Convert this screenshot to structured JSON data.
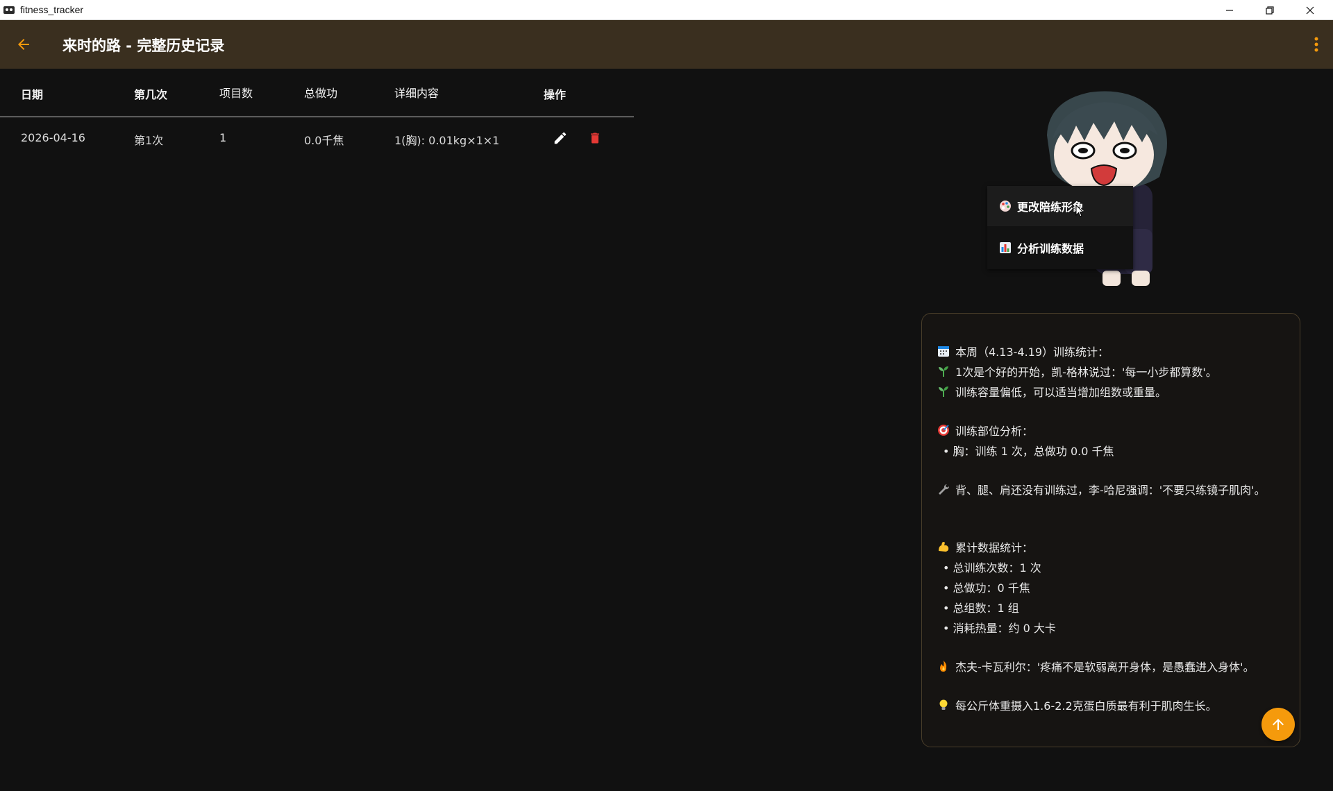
{
  "window": {
    "title": "fitness_tracker"
  },
  "appbar": {
    "title": "来时的路 - 完整历史记录"
  },
  "table": {
    "headers": {
      "date": "日期",
      "nth": "第几次",
      "items": "项目数",
      "work": "总做功",
      "detail": "详细内容",
      "actions": "操作"
    },
    "rows": [
      {
        "date": "2026-04-16",
        "nth": "第1次",
        "items": "1",
        "work": "0.0千焦",
        "detail": "1(胸): 0.01kg×1×1"
      }
    ]
  },
  "menu": {
    "items": [
      {
        "label": "更改陪练形象",
        "icon": "palette-icon"
      },
      {
        "label": "分析训练数据",
        "icon": "bar-chart-icon"
      }
    ]
  },
  "stats": {
    "week_title": "本周（4.13-4.19）训练统计：",
    "week_lines": [
      "1次是个好的开始，凯-格林说过：'每一小步都算数'。",
      "训练容量偏低，可以适当增加组数或重量。"
    ],
    "parts_title": "训练部位分析：",
    "parts_lines": [
      "• 胸：训练 1 次，总做功 0.0 千焦"
    ],
    "untrained": "背、腿、肩还没有训练过，李-哈尼强调：'不要只练镜子肌肉'。",
    "cumulative_title": "累计数据统计：",
    "cumulative_lines": [
      "• 总训练次数：1 次",
      "• 总做功：0 千焦",
      "• 总组数：1 组",
      "• 消耗热量：约 0 大卡"
    ],
    "quote": "杰夫-卡瓦利尔：'疼痛不是软弱离开身体，是愚蠢进入身体'。",
    "tip": "每公斤体重摄入1.6-2.2克蛋白质最有利于肌肉生长。"
  },
  "colors": {
    "accent": "#f59a0c",
    "appbar": "#3a2f1f",
    "background": "#111111",
    "delete": "#e53935"
  }
}
